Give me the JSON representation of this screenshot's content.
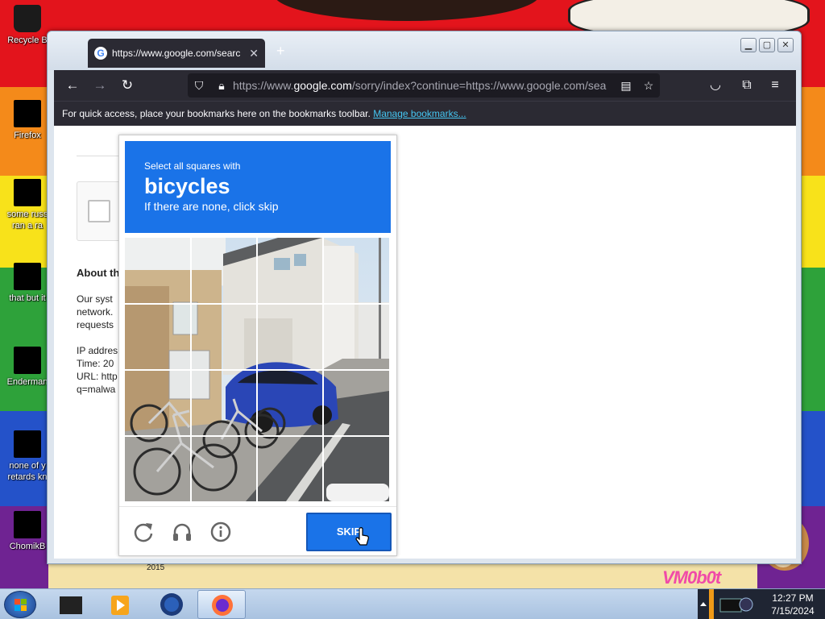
{
  "desktop": {
    "icons": [
      {
        "label": "Recycle B",
        "name": "recycle-bin"
      },
      {
        "label": "Firefox",
        "name": "firefox"
      },
      {
        "label": "some russ ran a ra",
        "name": "some-russ"
      },
      {
        "label": "that but it",
        "name": "that-but-it"
      },
      {
        "label": "Enderman",
        "name": "enderman"
      },
      {
        "label": "none of y retards kn",
        "name": "none-of-y"
      },
      {
        "label": "ChomikB",
        "name": "chomikb"
      }
    ],
    "wallpaper_texts": {
      "vm": "VM0b0t",
      "year": "2015"
    }
  },
  "browser": {
    "tab_title": "https://www.google.com/searc",
    "tab_close": "✕",
    "new_tab": "+",
    "url_prefix": "https://www.",
    "url_host": "google.com",
    "url_rest": "/sorry/index?continue=https://www.google.com/sea",
    "bookmarks_text": "For quick access, place your bookmarks here on the bookmarks toolbar.",
    "bookmarks_link": "Manage bookmarks..."
  },
  "page": {
    "about": "About th",
    "lines": [
      "Our syst",
      "network.",
      "requests",
      "IP addres",
      "Time: 20",
      "URL: http",
      "q=malwa"
    ]
  },
  "captcha": {
    "instruction": "Select all squares with",
    "target": "bicycles",
    "note": "If there are none, click skip",
    "skip": "SKIP",
    "colors": {
      "blue": "#1a73e8"
    }
  },
  "taskbar": {
    "time": "12:27 PM",
    "date": "7/15/2024"
  }
}
